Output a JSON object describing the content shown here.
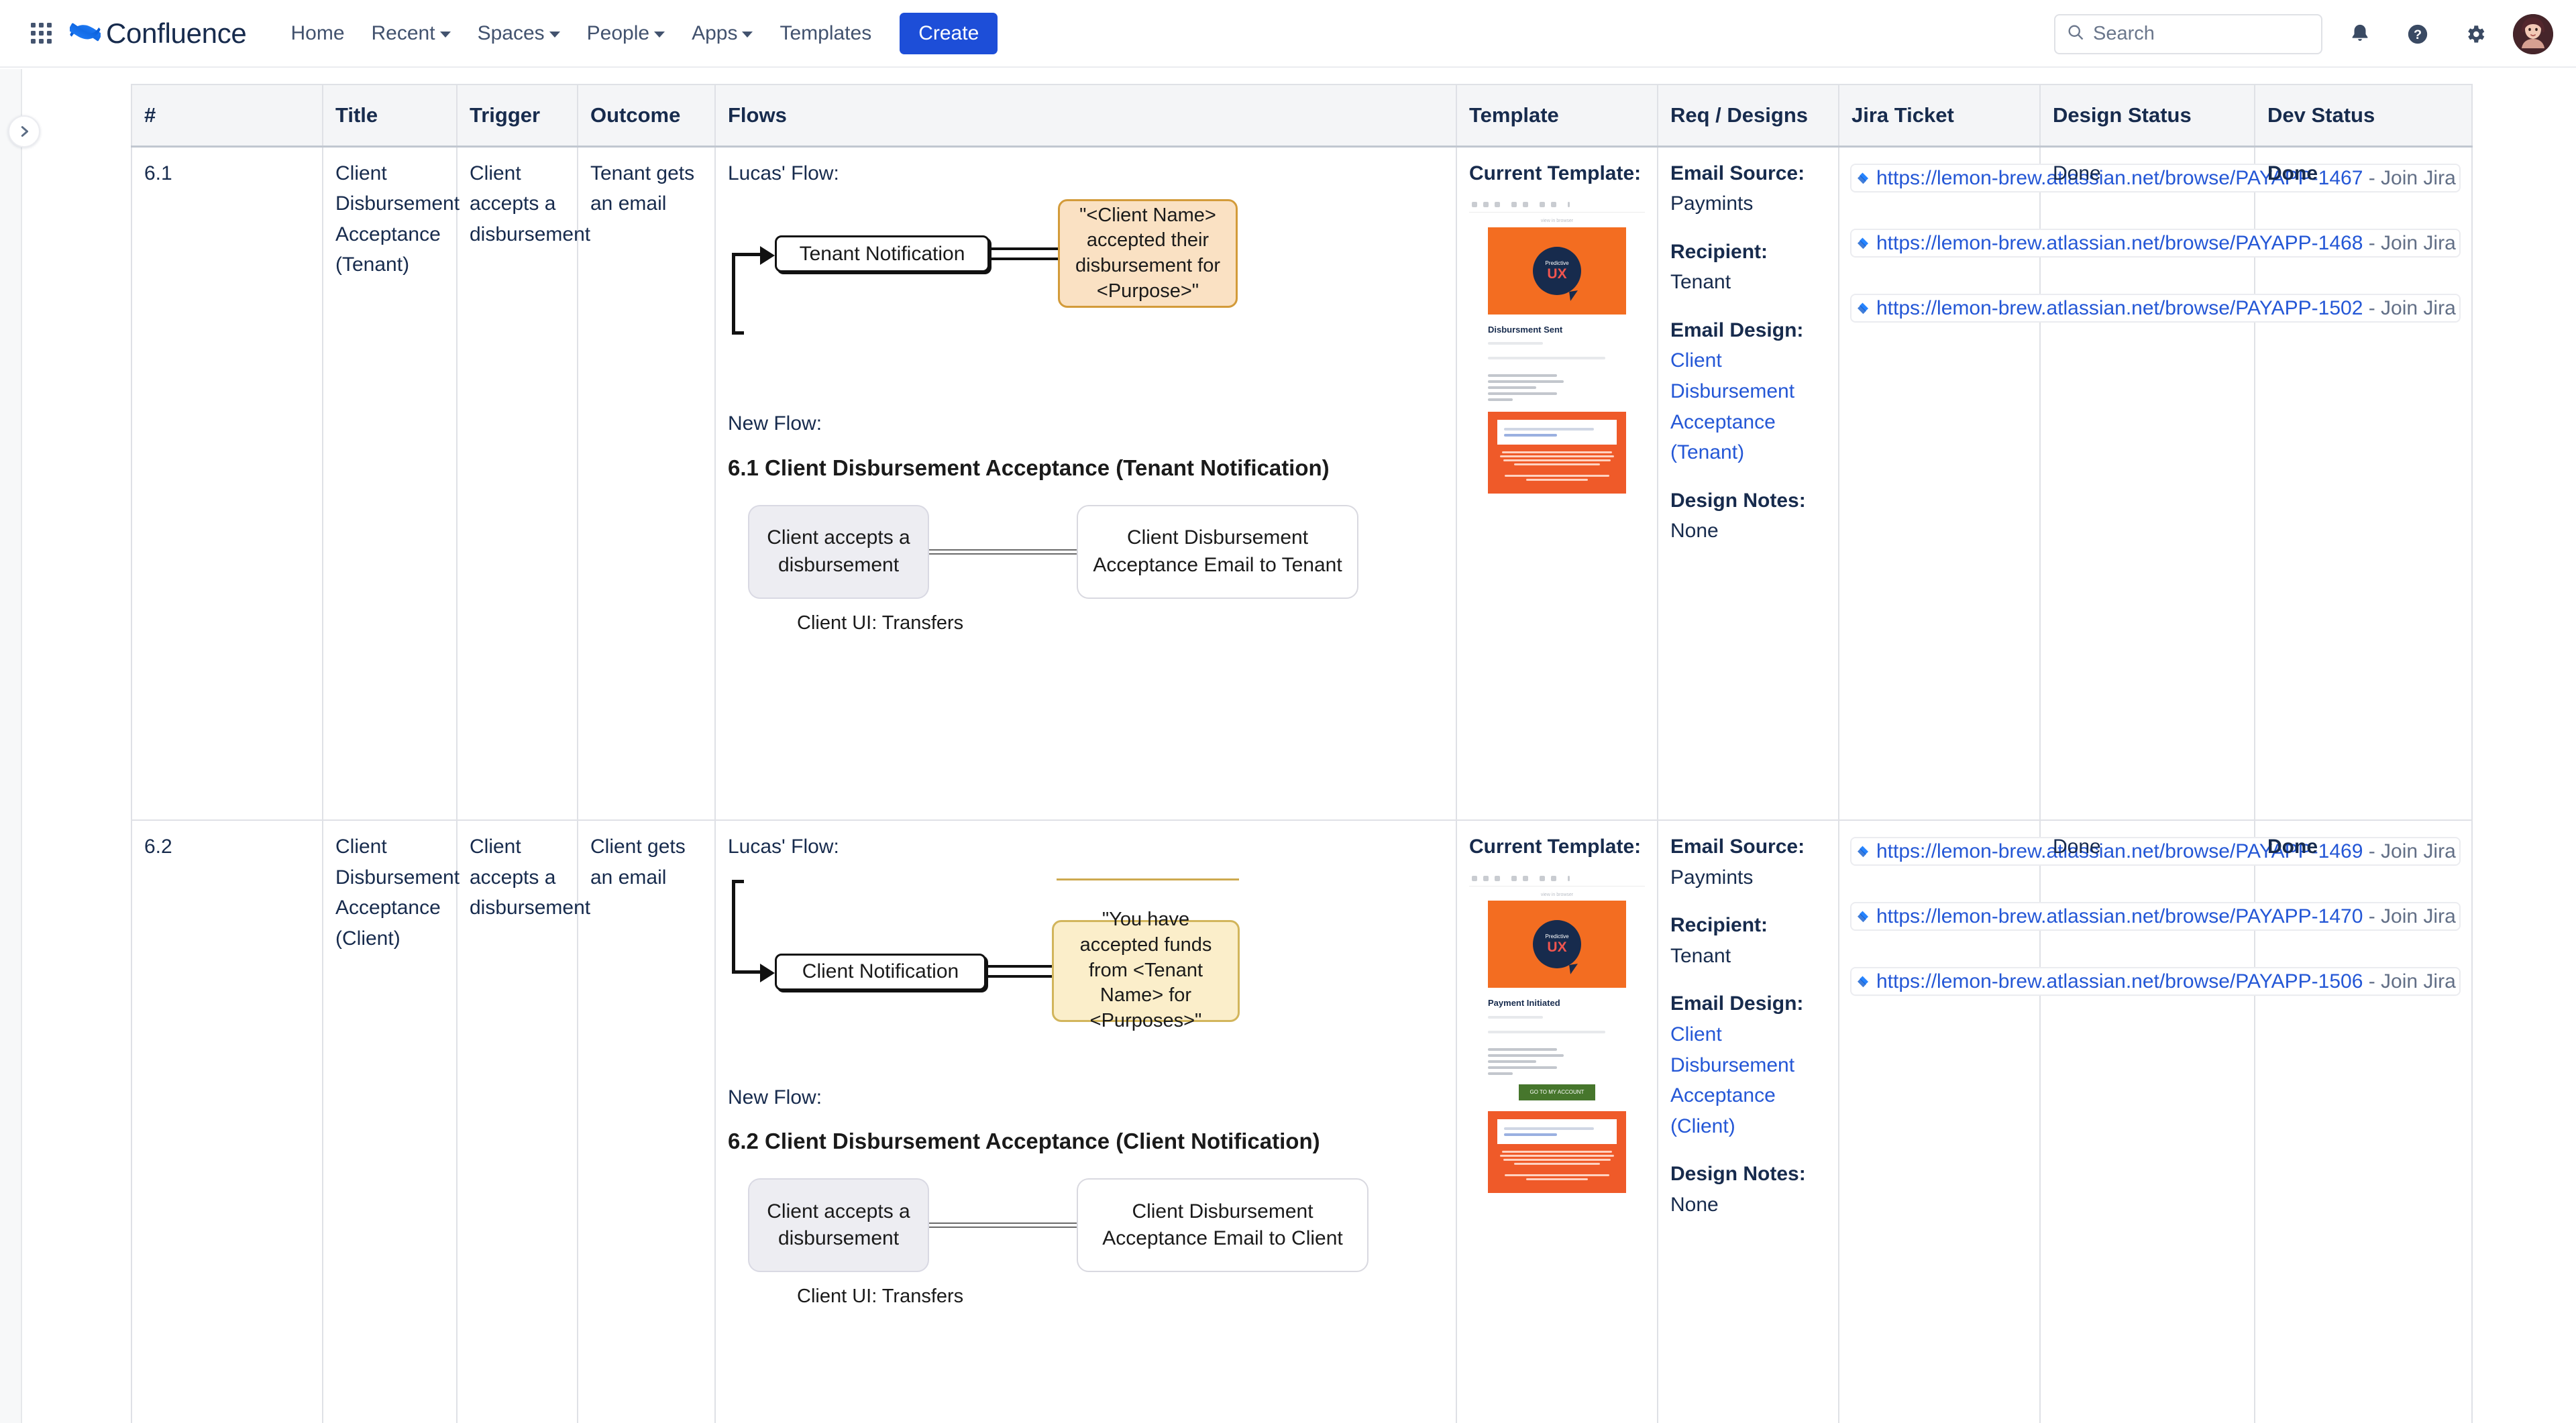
{
  "nav": {
    "app_switcher": "app-switcher",
    "brand": "Confluence",
    "items": [
      {
        "label": "Home",
        "caret": false
      },
      {
        "label": "Recent",
        "caret": true
      },
      {
        "label": "Spaces",
        "caret": true
      },
      {
        "label": "People",
        "caret": true
      },
      {
        "label": "Apps",
        "caret": true
      },
      {
        "label": "Templates",
        "caret": false
      }
    ],
    "create_label": "Create",
    "search_placeholder": "Search",
    "icons": [
      "notifications-icon",
      "help-icon",
      "settings-icon",
      "profile-avatar"
    ],
    "accent": "#1d4ed8"
  },
  "sidebar": {
    "expand_label": "Expand sidebar"
  },
  "table": {
    "headers": [
      "#",
      "Title",
      "Trigger",
      "Outcome",
      "Flows",
      "Template",
      "Req / Designs",
      "Jira Ticket",
      "Design Status",
      "Dev Status"
    ],
    "rows": [
      {
        "num": "6.1",
        "title": "Client Disbursement Acceptance (Tenant)",
        "trigger": "Client accepts a disbursement",
        "outcome": "Tenant gets an email",
        "flows": {
          "lucas_label": "Lucas' Flow:",
          "lucas_node": "Tenant Notification",
          "lucas_message": "\"<Client Name> accepted their disbursement for <Purpose>\"",
          "message_style": "peach",
          "new_label": "New Flow:",
          "new_title": "6.1 Client Disbursement Acceptance (Tenant Notification)",
          "new_left": "Client accepts a disbursement",
          "new_right": "Client Disbursement Acceptance Email to Tenant",
          "caption": "Client UI: Transfers"
        },
        "template": {
          "label": "Current Template:",
          "thumb_heading": "Disbursment Sent",
          "thumb_logo_top": "Predictive",
          "thumb_logo_bottom": "UX",
          "thumb_has_cta": false
        },
        "req": {
          "email_source_label": "Email Source:",
          "email_source": "Paymints",
          "recipient_label": "Recipient:",
          "recipient": "Tenant",
          "email_design_label": "Email Design:",
          "email_design": "Client Disbursement Acceptance (Tenant)",
          "design_notes_label": "Design Notes:",
          "design_notes": "None"
        },
        "jira": [
          {
            "url": "https://lemon-brew.atlassian.net/browse/PAYAPP-1467",
            "tail": " - Join Jira"
          },
          {
            "url": "https://lemon-brew.atlassian.net/browse/PAYAPP-1468",
            "tail": " - Join Jira"
          },
          {
            "url": "https://lemon-brew.atlassian.net/browse/PAYAPP-1502",
            "tail": " - Join Jira"
          }
        ],
        "design_status": "Done",
        "dev_status": "Done"
      },
      {
        "num": "6.2",
        "title": "Client Disbursement Acceptance (Client)",
        "trigger": "Client accepts a disbursement",
        "outcome": "Client gets an email",
        "flows": {
          "lucas_label": "Lucas' Flow:",
          "lucas_node": "Client Notification",
          "lucas_message": "\"You have accepted funds from <Tenant Name> for <Purposes>\"",
          "message_style": "yellow",
          "new_label": "New Flow:",
          "new_title": "6.2 Client Disbursement Acceptance (Client Notification)",
          "new_left": "Client accepts a disbursement",
          "new_right": "Client Disbursement Acceptance Email to Client",
          "caption": "Client UI: Transfers"
        },
        "template": {
          "label": "Current Template:",
          "thumb_heading": "Payment Initiated",
          "thumb_logo_top": "Predictive",
          "thumb_logo_bottom": "UX",
          "thumb_cta": "GO TO MY ACCOUNT",
          "thumb_has_cta": true
        },
        "req": {
          "email_source_label": "Email Source:",
          "email_source": "Paymints",
          "recipient_label": "Recipient:",
          "recipient": "Tenant",
          "email_design_label": "Email Design:",
          "email_design": "Client Disbursement Acceptance (Client)",
          "design_notes_label": "Design Notes:",
          "design_notes": "None"
        },
        "jira": [
          {
            "url": "https://lemon-brew.atlassian.net/browse/PAYAPP-1469",
            "tail": " - Join Jira"
          },
          {
            "url": "https://lemon-brew.atlassian.net/browse/PAYAPP-1470",
            "tail": " - Join Jira"
          },
          {
            "url": "https://lemon-brew.atlassian.net/browse/PAYAPP-1506",
            "tail": " - Join Jira"
          }
        ],
        "design_status": "Done",
        "dev_status": "Done"
      }
    ]
  }
}
